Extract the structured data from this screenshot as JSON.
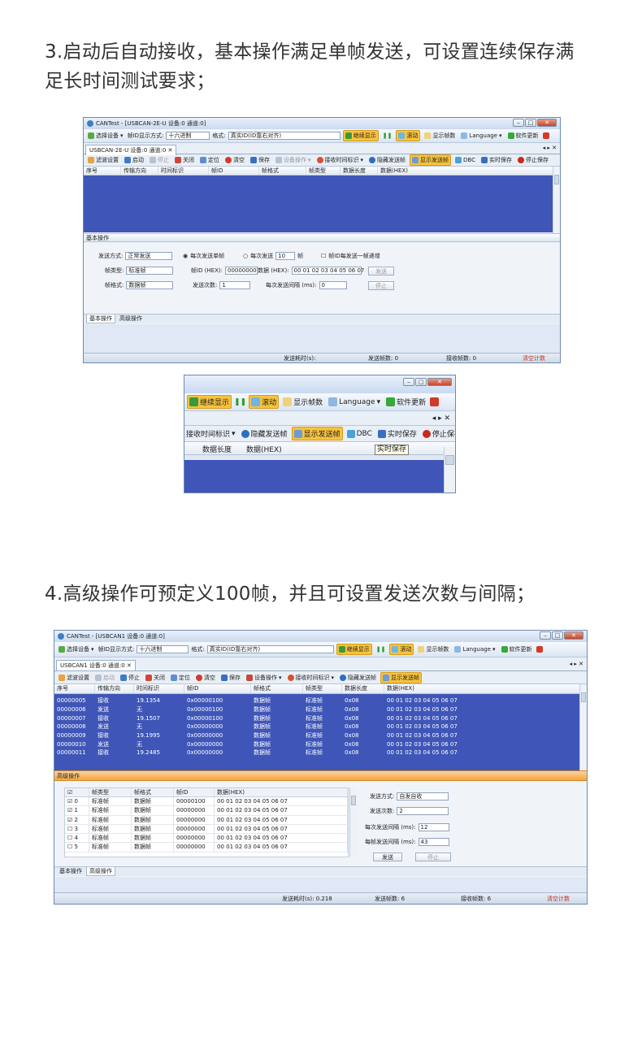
{
  "section3": {
    "caption_line1": "3.启动后自动接收，基本操作满足单帧发送，可设置连续保存满",
    "caption_line2": "足长时间测试要求；",
    "window": {
      "title": "CANTest - [USBCAN-2E-U 设备:0 通道:0]",
      "toolbar": {
        "select_device": "选择设备",
        "id_mode_label": "帧ID显示方式:",
        "id_mode_value": "十六进制",
        "format_label": "格式:",
        "format_value": "真实ID(ID靠右对齐)",
        "continue_display": "继续显示",
        "scroll": "滚动",
        "show_frames": "显示帧数",
        "language": "Language",
        "update": "软件更新"
      },
      "tab": "USBCAN-2E-U 设备:0 通道:0",
      "toolbar2": {
        "filter": "滤波设置",
        "start": "启动",
        "stop": "停止",
        "close": "关闭",
        "locate": "定位",
        "clear": "清空",
        "save": "保存",
        "device_op": "设备操作",
        "recv_time": "接收时间标识",
        "hide_send": "隐藏发送帧",
        "show_send": "显示发送帧",
        "dbc": "DBC",
        "realtime_save": "实时保存",
        "stop_save": "停止保存"
      },
      "columns": [
        "序号",
        "传输方向",
        "时间标识",
        "帧ID",
        "帧格式",
        "帧类型",
        "数据长度",
        "数据(HEX)"
      ],
      "basic_ops_title": "基本操作",
      "form": {
        "send_mode_label": "发送方式:",
        "send_mode_value": "正常发送",
        "radio_single": "每次发送单帧",
        "radio_multi": "每次发送",
        "multi_count": "10",
        "frames_unit": "帧",
        "id_incr": "帧ID每发送一帧递增",
        "frame_type_label": "帧类型:",
        "frame_type_value": "标准帧",
        "frame_id_label": "帧ID (HEX):",
        "frame_id_value": "00000000",
        "data_label": "数据 (HEX):",
        "data_value": "00 01 02 03 04 05 06 07",
        "send_btn": "发送",
        "frame_format_label": "帧格式:",
        "frame_format_value": "数据帧",
        "send_count_label": "发送次数:",
        "send_count_value": "1",
        "interval_label": "每次发送间隔 (ms):",
        "interval_value": "0",
        "stop_btn": "停止"
      },
      "bottom_tabs": [
        "基本操作",
        "高级操作"
      ],
      "status": {
        "elapsed": "发送耗时(s):",
        "sent": "发送帧数: 0",
        "recv": "接收帧数: 0",
        "clear": "清空计数"
      }
    },
    "zoom": {
      "continue_display": "继续显示",
      "scroll": "滚动",
      "show_frames": "显示帧数",
      "language": "Language",
      "update": "软件更新",
      "recv_time": "接收时间标识",
      "hide_send": "隐藏发送帧",
      "show_send": "显示发送帧",
      "dbc": "DBC",
      "realtime_save": "实时保存",
      "stop_save": "停止保存",
      "col_len": "数据长度",
      "col_data": "数据(HEX)",
      "tooltip": "实时保存"
    }
  },
  "section4": {
    "caption": "4.高级操作可预定义100帧，并且可设置发送次数与间隔；",
    "window": {
      "title": "CANTest - [USBCAN1 设备:0 通道:0]",
      "tab": "USBCAN1 设备:0 通道:0",
      "rows": [
        [
          "00000005",
          "接收",
          "19.1354",
          "0x00000100",
          "数据帧",
          "标准帧",
          "0x08",
          "00 01 02 03 04 05 06 07"
        ],
        [
          "00000006",
          "发送",
          "无",
          "0x00000100",
          "数据帧",
          "标准帧",
          "0x08",
          "00 01 02 03 04 05 06 07"
        ],
        [
          "00000007",
          "接收",
          "19.1507",
          "0x00000100",
          "数据帧",
          "标准帧",
          "0x08",
          "00 01 02 03 04 05 06 07"
        ],
        [
          "00000008",
          "发送",
          "无",
          "0x00000000",
          "数据帧",
          "标准帧",
          "0x08",
          "00 01 02 03 04 05 06 07"
        ],
        [
          "00000009",
          "接收",
          "19.1995",
          "0x00000000",
          "数据帧",
          "标准帧",
          "0x08",
          "00 01 02 03 04 05 06 07"
        ],
        [
          "00000010",
          "发送",
          "无",
          "0x00000000",
          "数据帧",
          "标准帧",
          "0x08",
          "00 01 02 03 04 05 06 07"
        ],
        [
          "00000011",
          "接收",
          "19.2485",
          "0x00000000",
          "数据帧",
          "标准帧",
          "0x08",
          "00 01 02 03 04 05 06 07"
        ]
      ],
      "adv_title": "高级操作",
      "adv_columns": [
        "☑",
        "帧类型",
        "帧格式",
        "帧ID",
        "数据(HEX)"
      ],
      "adv_rows": [
        [
          "☑ 0",
          "标准帧",
          "数据帧",
          "00000100",
          "00 01 02 03 04 05 06 07"
        ],
        [
          "☑ 1",
          "标准帧",
          "数据帧",
          "00000000",
          "00 01 02 03 04 05 06 07"
        ],
        [
          "☑ 2",
          "标准帧",
          "数据帧",
          "00000000",
          "00 01 02 03 04 05 06 07"
        ],
        [
          "☐ 3",
          "标准帧",
          "数据帧",
          "00000000",
          "00 01 02 03 04 05 06 07"
        ],
        [
          "☐ 4",
          "标准帧",
          "数据帧",
          "00000000",
          "00 01 02 03 04 05 06 07"
        ],
        [
          "☐ 5",
          "标准帧",
          "数据帧",
          "00000000",
          "00 01 02 03 04 05 06 07"
        ]
      ],
      "adv_form": {
        "send_mode_label": "发送方式:",
        "send_mode_value": "自发自收",
        "send_count_label": "发送次数:",
        "send_count_value": "2",
        "interval_label": "每次发送间隔 (ms):",
        "interval_value": "12",
        "frame_interval_label": "每帧发送间隔 (ms):",
        "frame_interval_value": "43",
        "send_btn": "发送",
        "stop_btn": "停止"
      },
      "status": {
        "elapsed": "发送耗时(s): 0.218",
        "sent": "发送帧数: 6",
        "recv": "接收帧数: 6",
        "clear": "清空计数"
      }
    }
  }
}
